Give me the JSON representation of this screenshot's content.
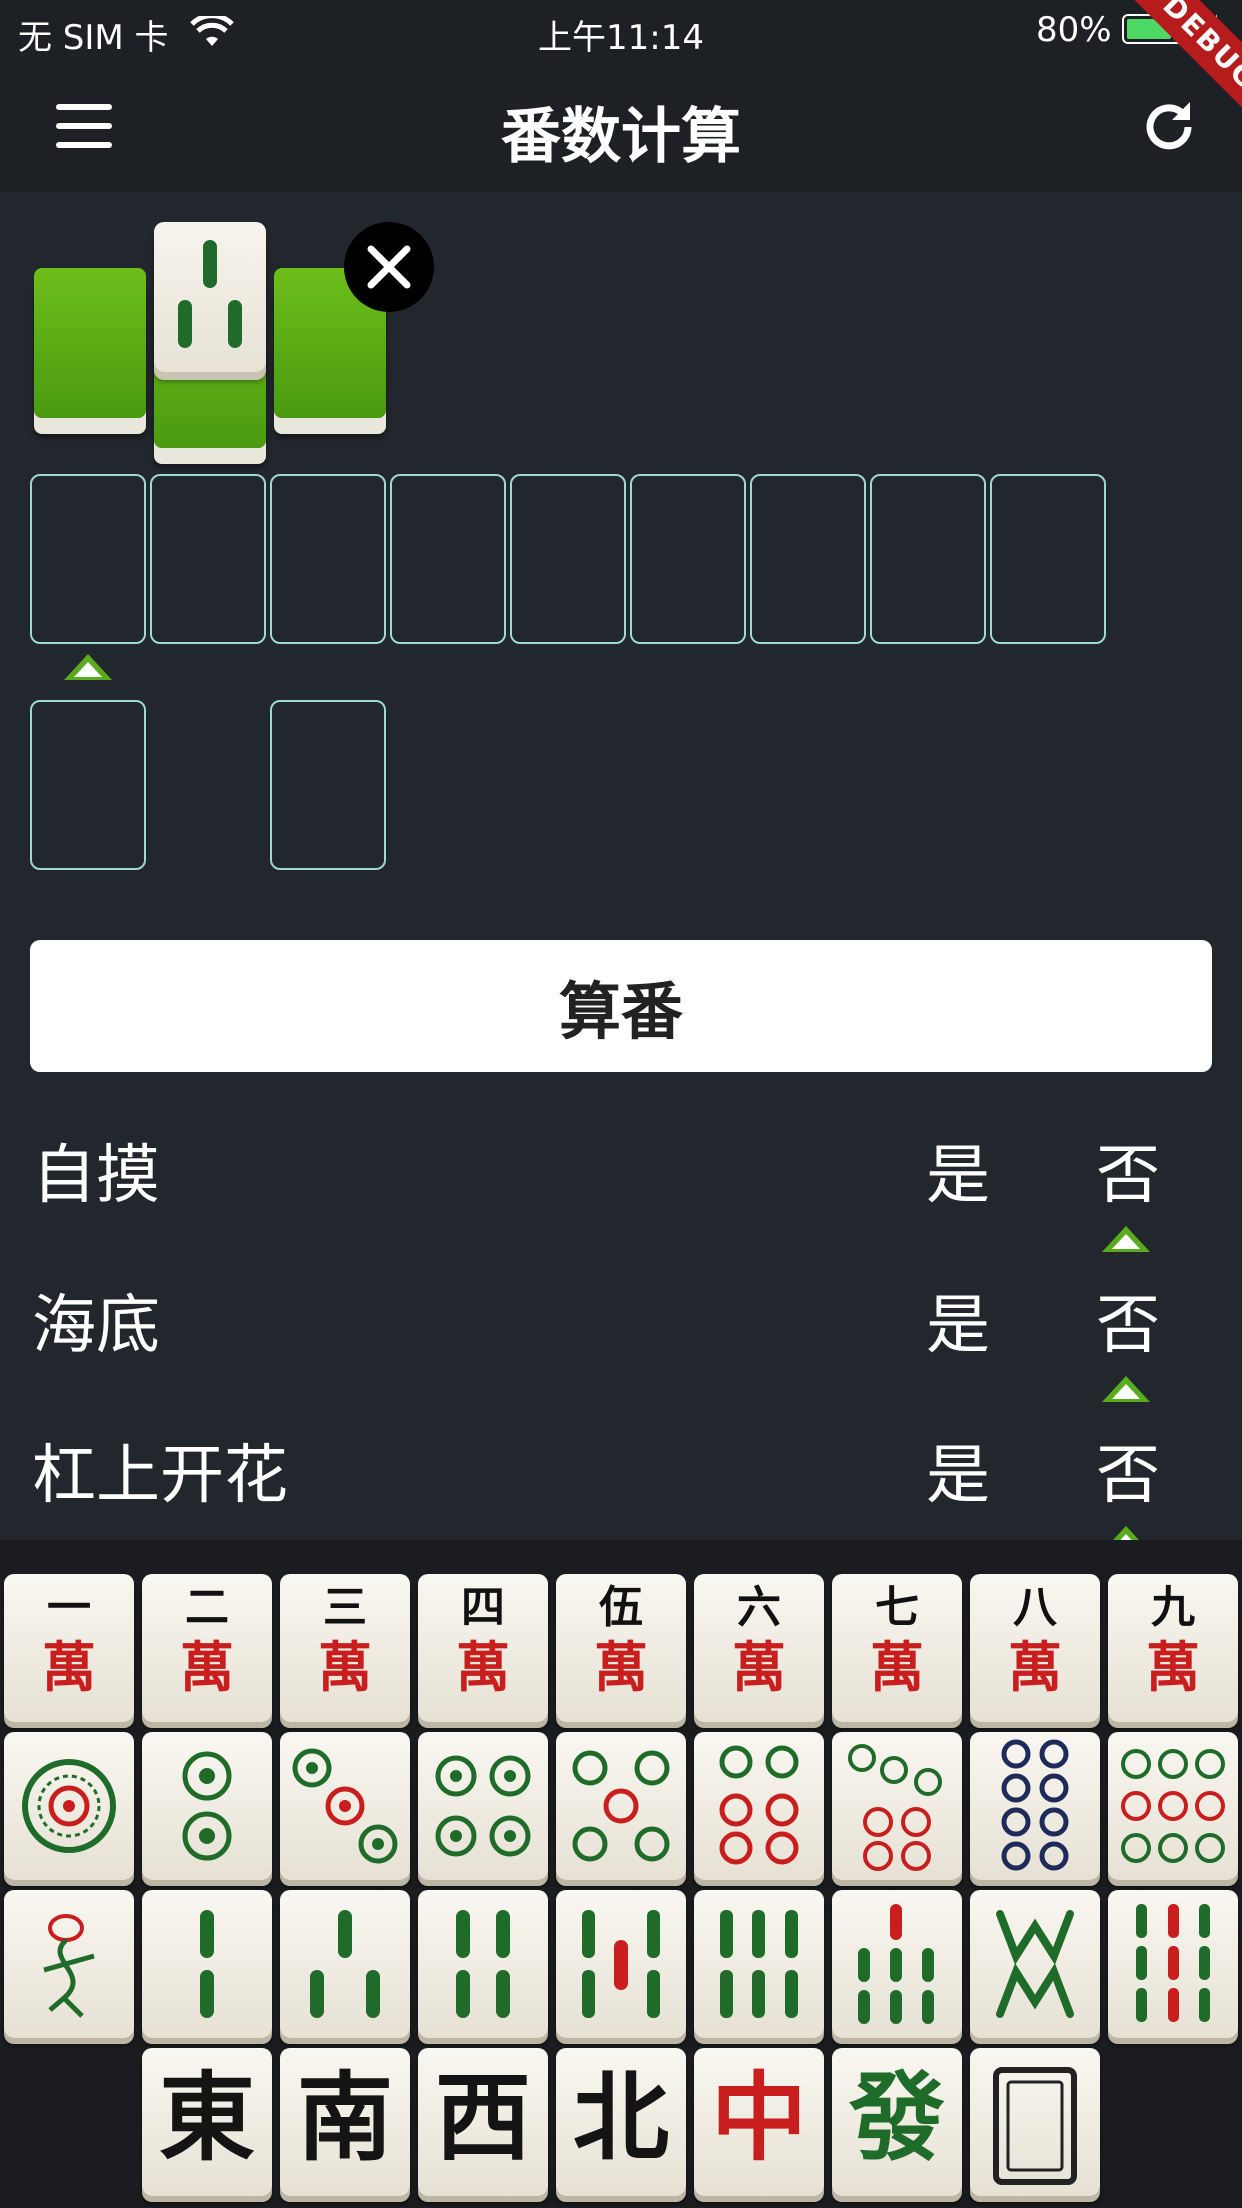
{
  "status": {
    "carrier": "无 SIM 卡",
    "time": "上午11:14",
    "battery": "80%",
    "battery_level": 0.8
  },
  "debug_banner": "DEBUG",
  "app": {
    "title": "番数计算"
  },
  "selected": {
    "tiles": [
      "green-back",
      "bamboo-3",
      "green-back"
    ],
    "remove_icon": "close-icon"
  },
  "calc_button": "算番",
  "options": [
    {
      "label": "自摸",
      "yes": "是",
      "no": "否",
      "selected": "no"
    },
    {
      "label": "海底",
      "yes": "是",
      "no": "否",
      "selected": "no"
    },
    {
      "label": "杠上开花",
      "yes": "是",
      "no": "否",
      "selected": "no"
    }
  ],
  "keyboard": {
    "characters": [
      {
        "num": "一",
        "suit": "萬"
      },
      {
        "num": "二",
        "suit": "萬"
      },
      {
        "num": "三",
        "suit": "萬"
      },
      {
        "num": "四",
        "suit": "萬"
      },
      {
        "num": "伍",
        "suit": "萬"
      },
      {
        "num": "六",
        "suit": "萬"
      },
      {
        "num": "七",
        "suit": "萬"
      },
      {
        "num": "八",
        "suit": "萬"
      },
      {
        "num": "九",
        "suit": "萬"
      }
    ],
    "dots": [
      "1",
      "2",
      "3",
      "4",
      "5",
      "6",
      "7",
      "8",
      "9"
    ],
    "bamboo": [
      "1",
      "2",
      "3",
      "4",
      "5",
      "6",
      "7",
      "8",
      "9"
    ],
    "honors": [
      {
        "char": "東",
        "color": "black"
      },
      {
        "char": "南",
        "color": "black"
      },
      {
        "char": "西",
        "color": "black"
      },
      {
        "char": "北",
        "color": "black"
      },
      {
        "char": "中",
        "color": "red"
      },
      {
        "char": "發",
        "color": "green"
      },
      {
        "char": "",
        "color": "white-dragon"
      }
    ]
  },
  "colors": {
    "background": "#22272d",
    "slot_border": "#9ed8cf",
    "indicator": "#5aaa1e",
    "bamboo_green": "#1f6b2a",
    "dot_red": "#c81e1e"
  }
}
